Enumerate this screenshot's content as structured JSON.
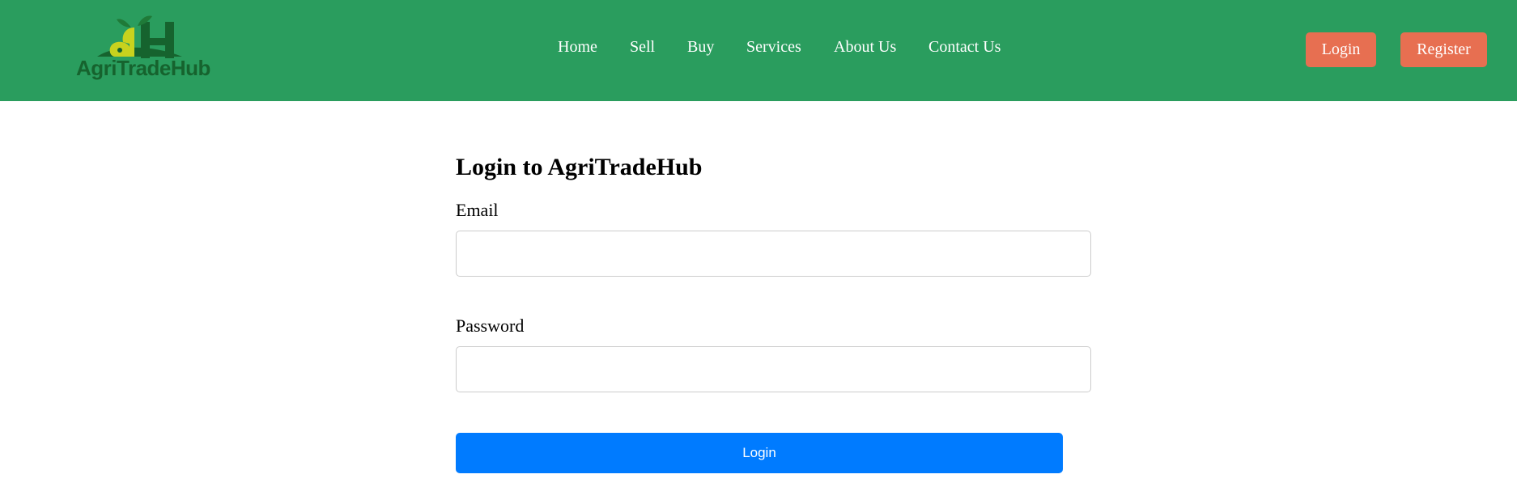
{
  "brand": {
    "name": "AgriTradeHub",
    "logo_mark": "aH",
    "colors": {
      "nav_bg": "#2a9d5e",
      "logo_green": "#16632e",
      "logo_yellow": "#c8d21e"
    }
  },
  "nav": {
    "links": [
      {
        "label": "Home"
      },
      {
        "label": "Sell"
      },
      {
        "label": "Buy"
      },
      {
        "label": "Services"
      },
      {
        "label": "About Us"
      },
      {
        "label": "Contact Us"
      }
    ],
    "login_label": "Login",
    "register_label": "Register",
    "button_color": "#e76f51"
  },
  "form": {
    "title": "Login to AgriTradeHub",
    "email_label": "Email",
    "email_value": "",
    "password_label": "Password",
    "password_value": "",
    "submit_label": "Login",
    "submit_color": "#007bff"
  }
}
